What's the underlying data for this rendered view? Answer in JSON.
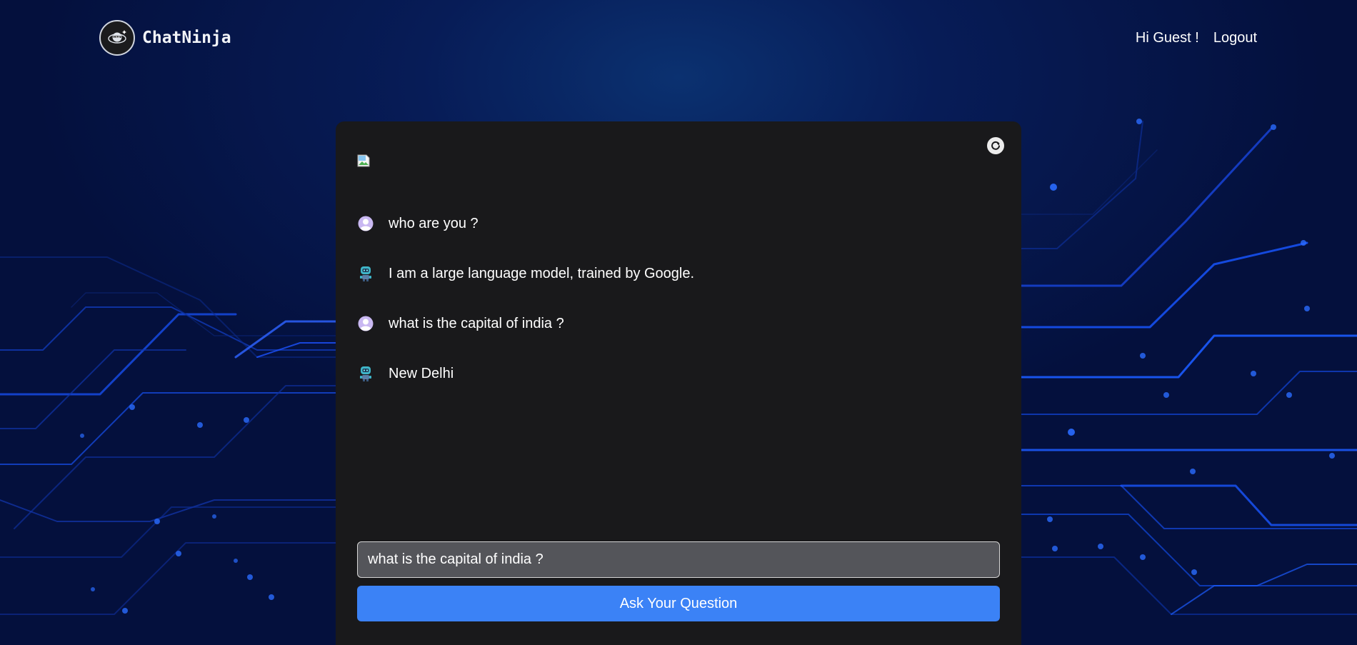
{
  "header": {
    "brand_name": "ChatNinja",
    "greeting": "Hi Guest !",
    "logout_label": "Logout"
  },
  "chat": {
    "messages": [
      {
        "role": "user",
        "text": "who are you ?"
      },
      {
        "role": "bot",
        "text": "I am a large language model, trained by Google."
      },
      {
        "role": "user",
        "text": "what is the capital of india ?"
      },
      {
        "role": "bot",
        "text": "New Delhi"
      }
    ],
    "input_value": "what is the capital of india ?",
    "ask_button_label": "Ask Your Question"
  },
  "colors": {
    "card_background": "#19191b",
    "button_blue": "#3b82f6",
    "input_background": "#54555a",
    "page_background": "#071c57"
  },
  "icons": {
    "logo": "ninja-logo-icon",
    "reset": "refresh-icon",
    "user_avatar": "user-avatar-icon",
    "bot_avatar": "robot-avatar-icon",
    "broken_image": "broken-image-icon"
  }
}
